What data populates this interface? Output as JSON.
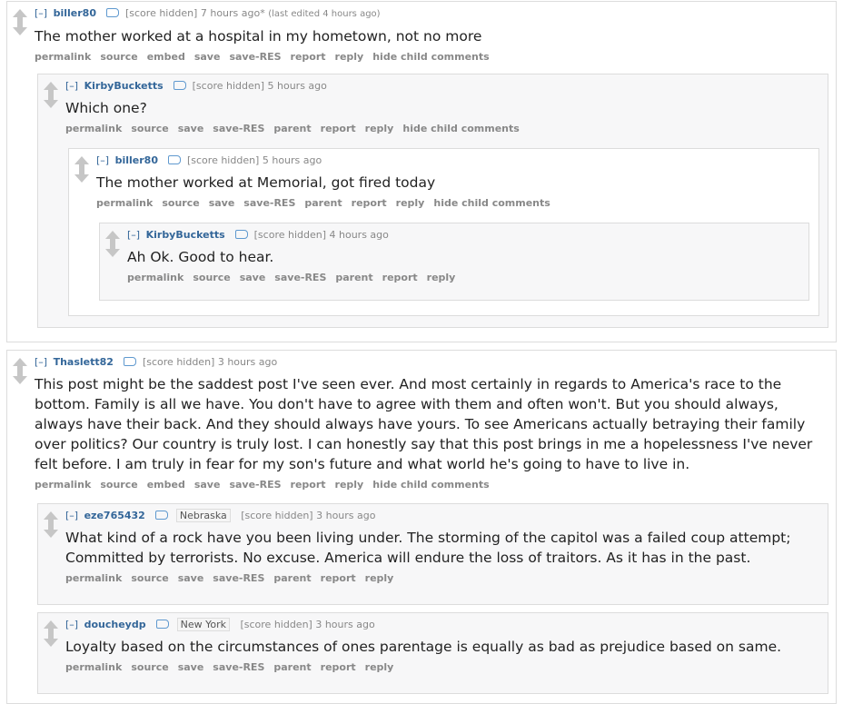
{
  "collapse_label": "[–]",
  "comments": [
    {
      "author": "biller80",
      "score": "[score hidden]",
      "time": "7 hours ago*",
      "edited": "(last edited 4 hours ago)",
      "body": "The mother worked at a hospital in my hometown, not no more",
      "actions": [
        "permalink",
        "source",
        "embed",
        "save",
        "save-RES",
        "report",
        "reply",
        "hide child comments"
      ]
    },
    {
      "author": "KirbyBucketts",
      "score": "[score hidden]",
      "time": "5 hours ago",
      "body": "Which one?",
      "actions": [
        "permalink",
        "source",
        "save",
        "save-RES",
        "parent",
        "report",
        "reply",
        "hide child comments"
      ]
    },
    {
      "author": "biller80",
      "score": "[score hidden]",
      "time": "5 hours ago",
      "body": "The mother worked at Memorial, got fired today",
      "actions": [
        "permalink",
        "source",
        "save",
        "save-RES",
        "parent",
        "report",
        "reply",
        "hide child comments"
      ]
    },
    {
      "author": "KirbyBucketts",
      "score": "[score hidden]",
      "time": "4 hours ago",
      "body": "Ah Ok. Good to hear.",
      "actions": [
        "permalink",
        "source",
        "save",
        "save-RES",
        "parent",
        "report",
        "reply"
      ]
    },
    {
      "author": "Thaslett82",
      "score": "[score hidden]",
      "time": "3 hours ago",
      "body": "This post might be the saddest post I've seen ever. And most certainly in regards to America's race to the bottom. Family is all we have. You don't have to agree with them and often won't. But you should always, always have their back. And they should always have yours. To see Americans actually betraying their family over politics? Our country is truly lost. I can honestly say that this post brings in me a hopelessness I've never felt before. I am truly in fear for my son's future and what world he's going to have to live in.",
      "actions": [
        "permalink",
        "source",
        "embed",
        "save",
        "save-RES",
        "report",
        "reply",
        "hide child comments"
      ]
    },
    {
      "author": "eze765432",
      "flair": "Nebraska",
      "score": "[score hidden]",
      "time": "3 hours ago",
      "body": "What kind of a rock have you been living under. The storming of the capitol was a failed coup attempt; Committed by terrorists. No excuse. America will endure the loss of traitors. As it has in the past.",
      "actions": [
        "permalink",
        "source",
        "save",
        "save-RES",
        "parent",
        "report",
        "reply"
      ]
    },
    {
      "author": "doucheydp",
      "flair": "New York",
      "score": "[score hidden]",
      "time": "3 hours ago",
      "body": "Loyalty based on the circumstances of ones parentage is equally as bad as prejudice based on same.",
      "actions": [
        "permalink",
        "source",
        "save",
        "save-RES",
        "parent",
        "report",
        "reply"
      ]
    }
  ]
}
